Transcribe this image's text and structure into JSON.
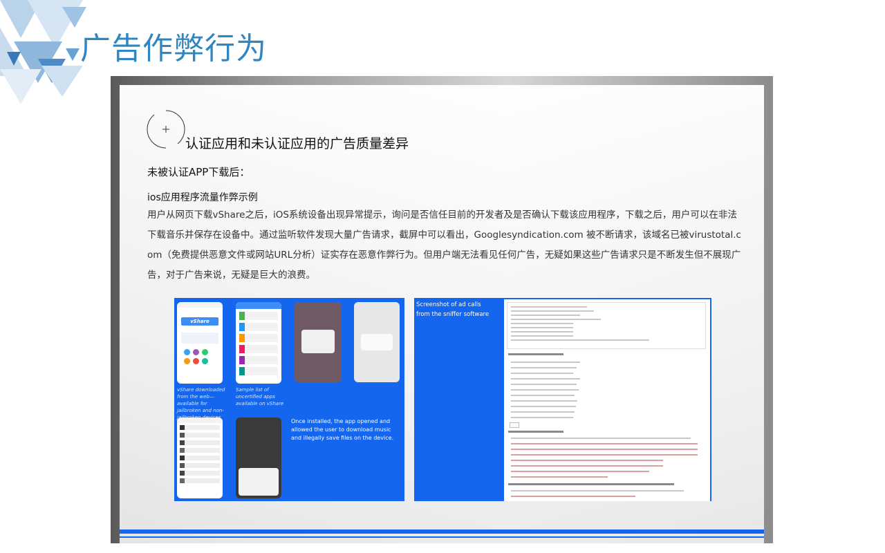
{
  "slide": {
    "title": "广告作弊行为"
  },
  "content": {
    "crosshair_symbol": "+",
    "section_heading": "认证应用和未认证应用的广告质量差异",
    "subheading": "未被认证APP下载后：",
    "small_title": "ios应用程序流量作弊示例",
    "body": "用户从网页下载vShare之后，iOS系统设备出现异常提示，询问是否信任目前的开发者及是否确认下载该应用程序，下载之后，用户可以在非法下载音乐并保存在设备中。通过监听软件发现大量广告请求，截屏中可以看出，Googlesyndication.com 被不断请求，该域名已被virustotal.com（免费提供恶意文件或网站URL分析）证实存在恶意作弊行为。但用户端无法看见任何广告，无疑如果这些广告请求只是不断发生但不展现广告，对于广告来说，无疑是巨大的浪费。"
  },
  "figure": {
    "caption_vshare": "vShare downloaded from the web—available for jailbroken and non-jailbroken devices",
    "caption_sample": "Sample list of uncertified apps available on vShare",
    "caption_installed": "Once installed, the app opened and allowed the user to download music and illegally save files on the device.",
    "caption_sniffer": "Screenshot of ad calls from the sniffer software",
    "app_logo": "vShare"
  },
  "colors": {
    "title_blue": "#2f86c0",
    "panel_blue": "#1466ee"
  }
}
